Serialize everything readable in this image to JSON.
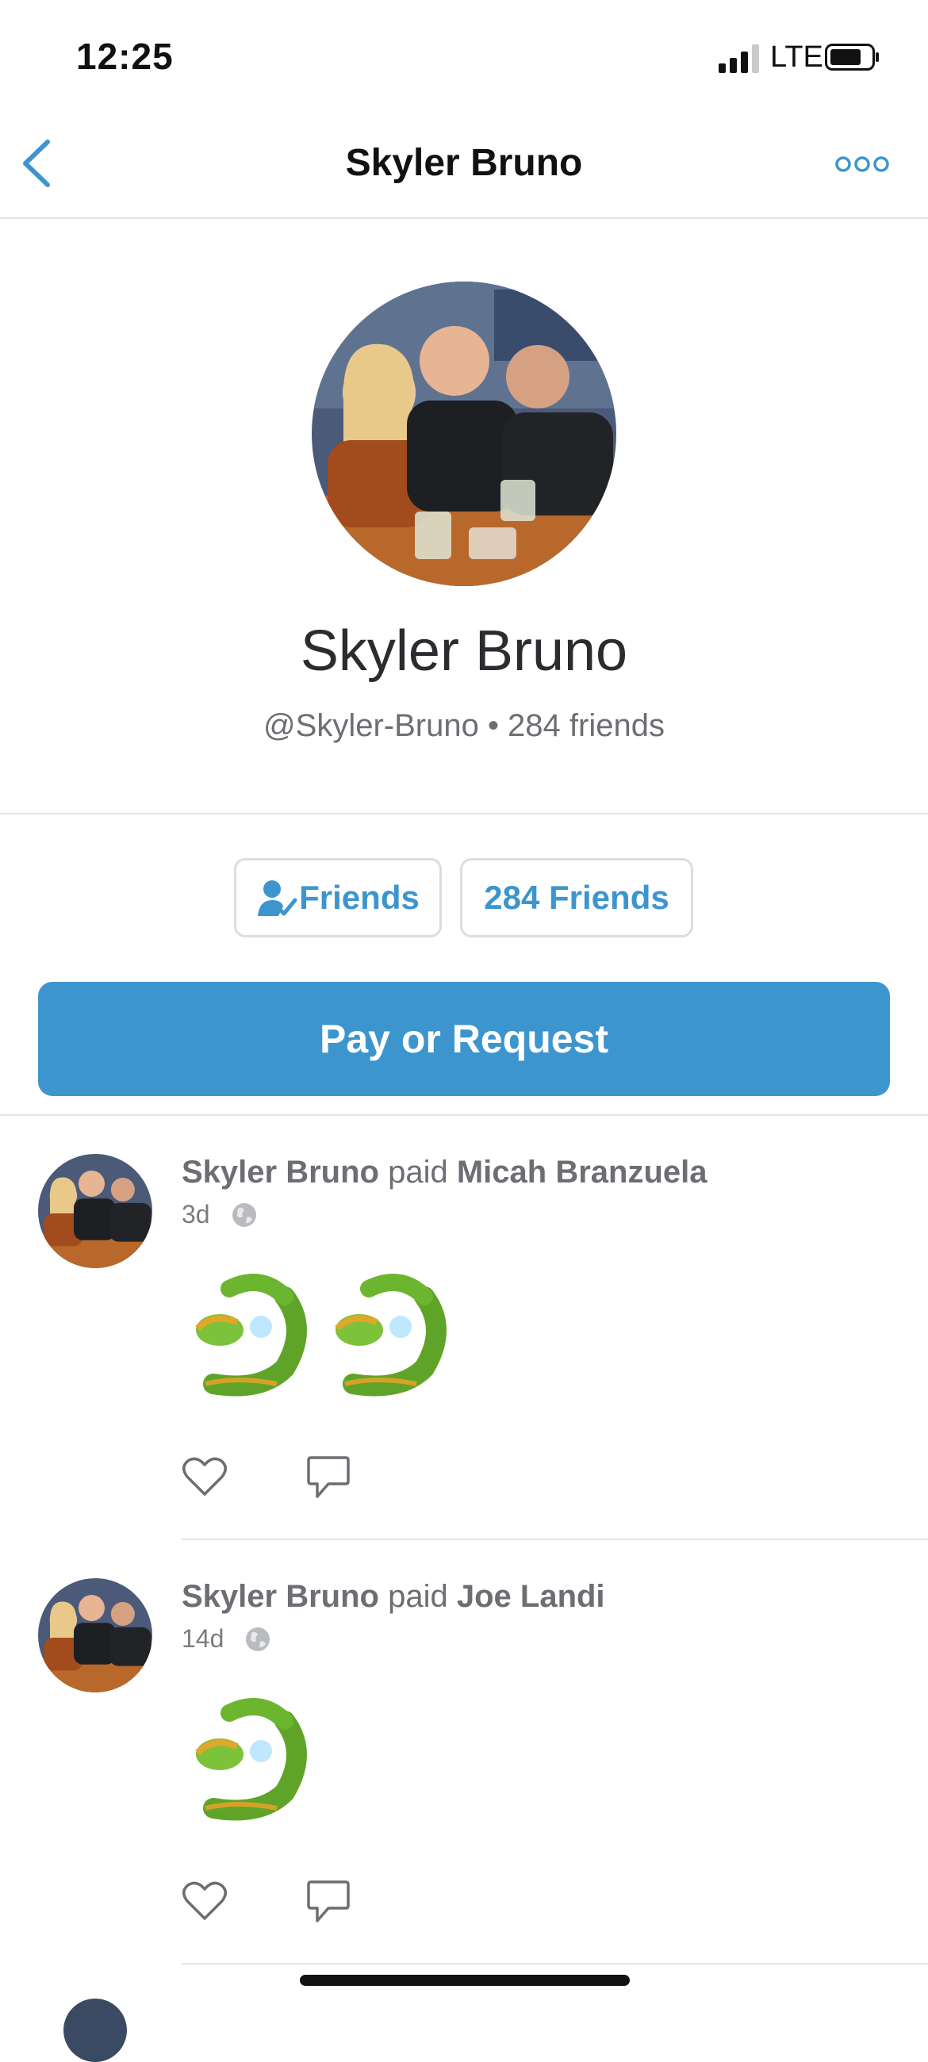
{
  "status_bar": {
    "time": "12:25",
    "network": "LTE"
  },
  "nav": {
    "title": "Skyler Bruno",
    "back_icon": "chevron-left-icon",
    "more_icon": "more-dots-icon"
  },
  "profile": {
    "name": "Skyler Bruno",
    "subtitle": "@Skyler-Bruno • 284 friends",
    "friends_button": "Friends",
    "friends_count_button": "284 Friends",
    "pay_button": "Pay or Request"
  },
  "feed": [
    {
      "actor": "Skyler Bruno",
      "verb": "paid",
      "target": "Micah Branzuela",
      "time": "3d",
      "note_emoji_count": 2
    },
    {
      "actor": "Skyler Bruno",
      "verb": "paid",
      "target": "Joe Landi",
      "time": "14d",
      "note_emoji_count": 1
    }
  ],
  "colors": {
    "accent": "#3d95ce",
    "divider": "#e3e4e6",
    "text_muted": "#6c6e73"
  }
}
